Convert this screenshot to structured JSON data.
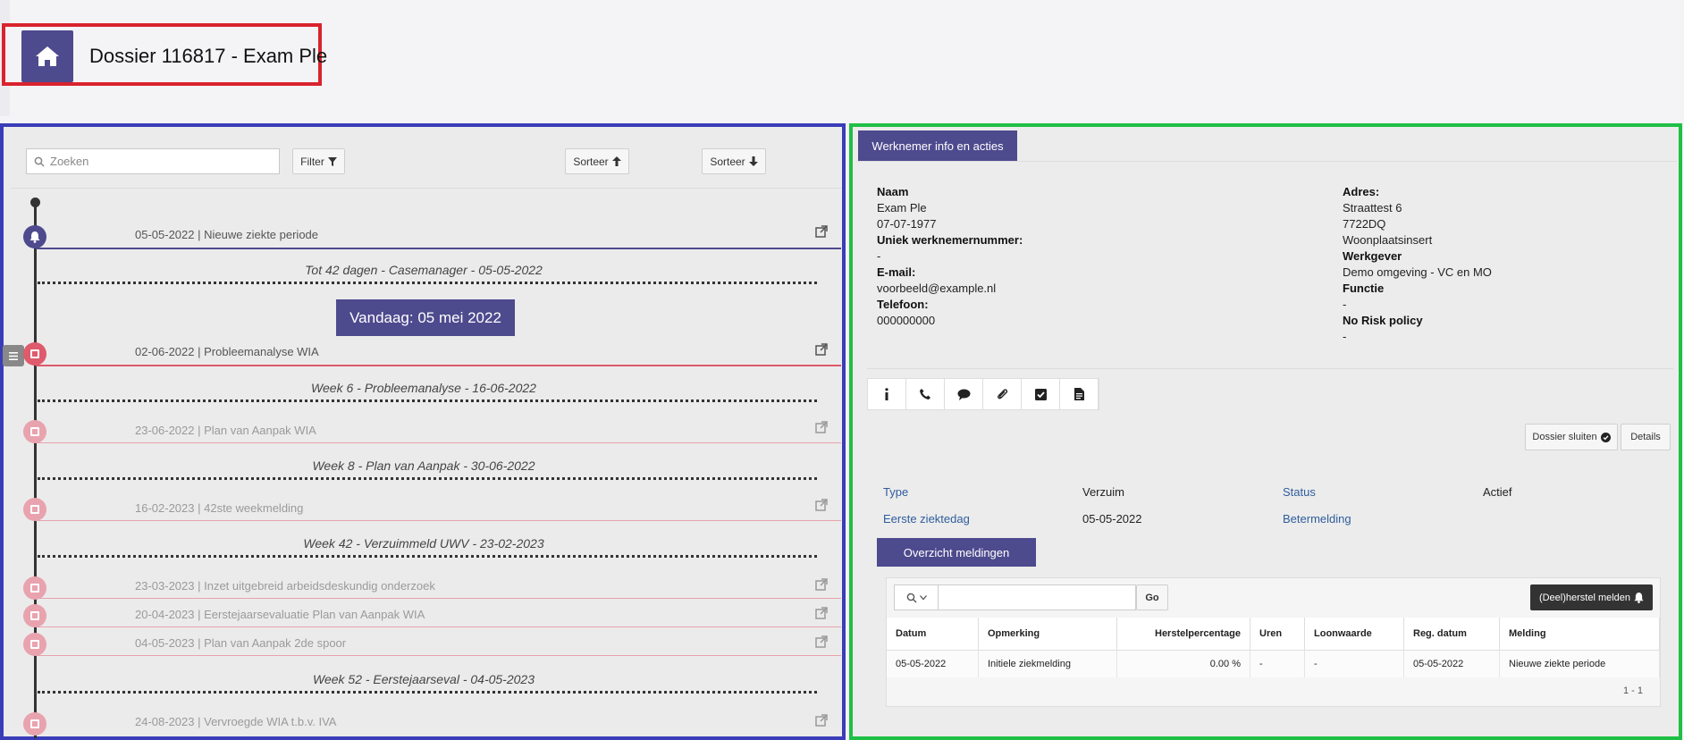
{
  "header": {
    "title": "Dossier 116817 - Exam Ple",
    "home_icon": "home-icon"
  },
  "timeline": {
    "search_placeholder": "Zoeken",
    "filter_label": "Filter",
    "sort_asc_label": "Sorteer",
    "sort_desc_label": "Sorteer",
    "today_label": "Vandaag: 05 mei 2022",
    "rows": [
      {
        "date": "05-05-2022",
        "text": "Nieuwe ziekte periode"
      },
      {
        "date": "02-06-2022",
        "text": "Probleemanalyse WIA"
      },
      {
        "date": "23-06-2022",
        "text": "Plan van Aanpak WIA"
      },
      {
        "date": "16-02-2023",
        "text": "42ste weekmelding"
      },
      {
        "date": "23-03-2023",
        "text": "Inzet uitgebreid arbeidsdeskundig onderzoek"
      },
      {
        "date": "20-04-2023",
        "text": "Eerstejaarsevaluatie Plan van Aanpak WIA"
      },
      {
        "date": "04-05-2023",
        "text": "Plan van Aanpak 2de spoor"
      },
      {
        "date": "24-08-2023",
        "text": "Vervroegde WIA t.b.v. IVA"
      }
    ],
    "phases": [
      "Tot 42 dagen - Casemanager - 05-05-2022",
      "Week 6 - Probleemanalyse - 16-06-2022",
      "Week 8 - Plan van Aanpak - 30-06-2022",
      "Week 42 - Verzuimmeld UWV - 23-02-2023",
      "Week 52 - Eerstejaarseval - 04-05-2023"
    ],
    "colors": {
      "purple": "#4e4a8e",
      "red": "#de5a6c",
      "pink": "#e8a3ae"
    }
  },
  "employee": {
    "tab_label": "Werknemer info en acties",
    "naam_label": "Naam",
    "naam": "Exam Ple",
    "geboortedatum": "07-07-1977",
    "uniek_label": "Uniek werknemernummer:",
    "uniek": "-",
    "email_label": "E-mail:",
    "email": "voorbeeld@example.nl",
    "telefoon_label": "Telefoon:",
    "telefoon": "000000000",
    "adres_label": "Adres:",
    "straat": "Straattest 6",
    "postcode": "7722DQ",
    "plaats": "Woonplaatsinsert",
    "werkgever_label": "Werkgever",
    "werkgever": "Demo omgeving - VC en MO",
    "functie_label": "Functie",
    "functie": "-",
    "norisk_label": "No Risk policy",
    "norisk": "-"
  },
  "icon_tabs": [
    "info-icon",
    "phone-icon",
    "comment-icon",
    "paperclip-icon",
    "checkbox-icon",
    "document-icon"
  ],
  "actions": {
    "dossier_sluiten": "Dossier sluiten",
    "details": "Details"
  },
  "case": {
    "type_label": "Type",
    "type_value": "Verzuim",
    "status_label": "Status",
    "status_value": "Actief",
    "eerste_label": "Eerste ziektedag",
    "eerste_value": "05-05-2022",
    "beter_label": "Betermelding"
  },
  "meldingen": {
    "tab_label": "Overzicht meldingen",
    "go_label": "Go",
    "herstel_label": "(Deel)herstel melden",
    "columns": [
      "Datum",
      "Opmerking",
      "Herstelpercentage",
      "Uren",
      "Loonwaarde",
      "Reg. datum",
      "Melding"
    ],
    "rows": [
      [
        "05-05-2022",
        "Initiele ziekmelding",
        "0.00 %",
        "-",
        "-",
        "05-05-2022",
        "Nieuwe ziekte periode"
      ]
    ],
    "pager": "1 - 1"
  }
}
